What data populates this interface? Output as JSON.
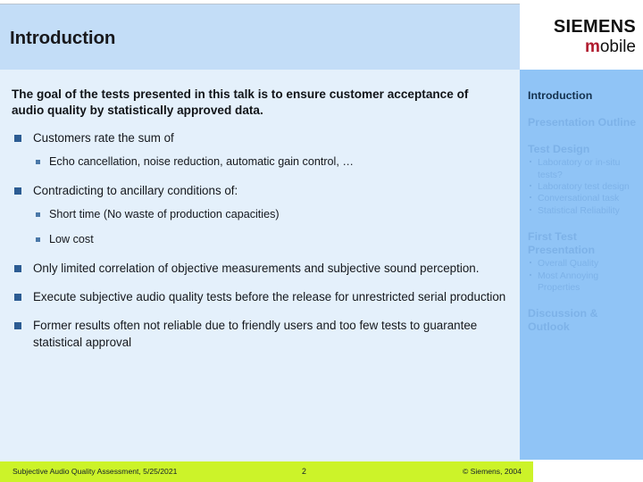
{
  "slide": {
    "title": "Introduction"
  },
  "logo": {
    "brand": "SIEMENS",
    "sub_accent": "m",
    "sub_rest": "obile"
  },
  "body": {
    "lead": "The goal of the tests presented in this talk is to ensure customer acceptance of audio quality by statistically approved data.",
    "bullets": [
      {
        "text": "Customers rate the sum of",
        "sub": [
          "Echo cancellation, noise reduction, automatic gain control, …"
        ]
      },
      {
        "text": "Contradicting to ancillary conditions of:",
        "sub": [
          "Short time (No waste of production capacities)",
          "Low cost"
        ]
      },
      {
        "text": "Only limited correlation of objective measurements and subjective sound perception.",
        "sub": []
      },
      {
        "text": "Execute subjective audio quality tests before the release for unrestricted serial production",
        "sub": []
      },
      {
        "text": "Former results often not reliable due to friendly users and too few tests to guarantee statistical approval",
        "sub": []
      }
    ]
  },
  "sidebar": {
    "sections": [
      {
        "label": "Introduction",
        "current": true,
        "items": []
      },
      {
        "label": "Presentation Outline",
        "current": false,
        "items": []
      },
      {
        "label": "Test Design",
        "current": false,
        "items": [
          "Laboratory or in-situ tests?",
          "Laboratory test design",
          "Conversational task",
          "Statistical Reliability"
        ]
      },
      {
        "label": "First Test Presentation",
        "current": false,
        "items": [
          "Overall Quality",
          "Most Annoying Properties"
        ]
      },
      {
        "label": "Discussion & Outlook",
        "current": false,
        "items": []
      }
    ]
  },
  "footer": {
    "left": "Subjective Audio Quality Assessment, 5/25/2021",
    "page": "2",
    "right": "© Siemens, 2004"
  },
  "colors": {
    "header_band": "#c3ddf7",
    "body_panel": "#e4f0fb",
    "sidebar": "#90c4f6",
    "footer": "#ccf329",
    "bullet_square": "#2c5c93",
    "logo_accent": "#b01b2e"
  }
}
